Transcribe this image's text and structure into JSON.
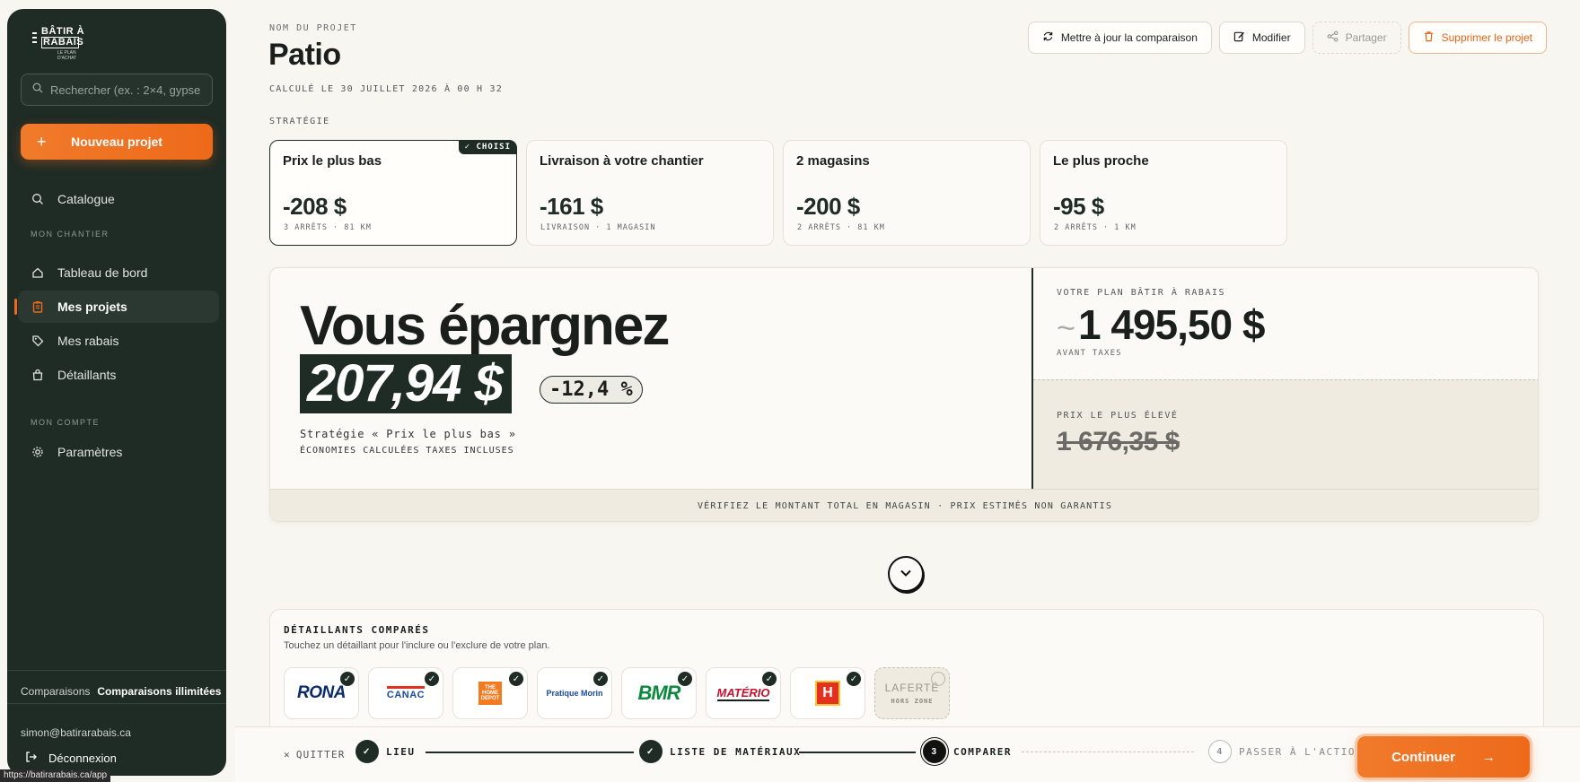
{
  "sidebar": {
    "logo": {
      "line1": "BÂTIR À",
      "line2": "RABAIS",
      "line3": "LE PLAN D'ACHAT"
    },
    "search_placeholder": "Rechercher (ex. : 2×4, gypse",
    "new_project": "Nouveau projet",
    "catalogue": "Catalogue",
    "section_chantier": "MON CHANTIER",
    "items": [
      {
        "label": "Tableau de bord",
        "icon": "home-icon"
      },
      {
        "label": "Mes projets",
        "icon": "clipboard-icon",
        "active": true
      },
      {
        "label": "Mes rabais",
        "icon": "tag-icon"
      },
      {
        "label": "Détaillants",
        "icon": "shopping-bag-icon"
      }
    ],
    "section_compte": "MON COMPTE",
    "settings": "Paramètres",
    "comparisons_label": "Comparaisons",
    "comparisons_value": "Comparaisons illimitées",
    "email": "simon@batirarabais.ca",
    "logout": "Déconnexion"
  },
  "url_tooltip": "https://batirarabais.ca/app",
  "project": {
    "label": "NOM DU PROJET",
    "title": "Patio",
    "calculated": "CALCULÉ LE 30 JUILLET 2026 À 00 H 32"
  },
  "actions": {
    "refresh": "Mettre à jour la comparaison",
    "edit": "Modifier",
    "share": "Partager",
    "delete": "Supprimer le projet"
  },
  "strategy": {
    "label": "STRATÉGIE",
    "chosen_badge": "CHOISI",
    "cards": [
      {
        "name": "Prix le plus bas",
        "amount": "-208 $",
        "meta": "3 ARRÊTS · 81 KM",
        "selected": true
      },
      {
        "name": "Livraison à votre chantier",
        "amount": "-161 $",
        "meta": "LIVRAISON · 1 MAGASIN"
      },
      {
        "name": "2 magasins",
        "amount": "-200 $",
        "meta": "2 ARRÊTS · 81 KM"
      },
      {
        "name": "Le plus proche",
        "amount": "-95 $",
        "meta": "2 ARRÊTS · 1 KM"
      }
    ]
  },
  "savings": {
    "headline": "Vous épargnez",
    "amount": "207,94 $",
    "percent": "-12,4 %",
    "strategy_quote": "Stratégie « Prix le plus bas »",
    "tax_note": "ÉCONOMIES CALCULÉES TAXES INCLUSES",
    "plan_label": "VOTRE PLAN BÂTIR À RABAIS",
    "plan_tilde": "~",
    "plan_amount": "1 495,50 $",
    "plan_note": "AVANT TAXES",
    "high_label": "PRIX LE PLUS ÉLEVÉ",
    "high_amount": "1 676,35 $",
    "footer": "VÉRIFIEZ LE MONTANT TOTAL EN MAGASIN · PRIX ESTIMÉS NON GARANTIS"
  },
  "retailers": {
    "title": "DÉTAILLANTS COMPARÉS",
    "subtitle": "Touchez un détaillant pour l'inclure ou l'exclure de votre plan.",
    "items": [
      {
        "name": "RONA",
        "included": true
      },
      {
        "name": "CANAC",
        "included": true
      },
      {
        "name": "THE HOME DEPOT",
        "included": true
      },
      {
        "name": "Pratique Morin",
        "included": true
      },
      {
        "name": "BMR",
        "included": true
      },
      {
        "name": "MATÉRIO",
        "included": true
      },
      {
        "name": "Home Hardware",
        "included": true
      },
      {
        "name": "LAFERTÉ",
        "included": false,
        "badge": "HORS ZONE"
      }
    ]
  },
  "stepper": {
    "quit": "QUITTER",
    "steps": [
      {
        "num": "1",
        "label": "LIEU",
        "status": "done"
      },
      {
        "num": "2",
        "label": "LISTE DE MATÉRIAUX",
        "status": "done"
      },
      {
        "num": "3",
        "label": "COMPARER",
        "status": "current"
      },
      {
        "num": "4",
        "label": "PASSER À L'ACTION",
        "status": "todo"
      }
    ],
    "continue": "Continuer"
  },
  "colors": {
    "accent": "#ee6a1a",
    "dark": "#1f2b25",
    "background": "#f8f6f0"
  }
}
